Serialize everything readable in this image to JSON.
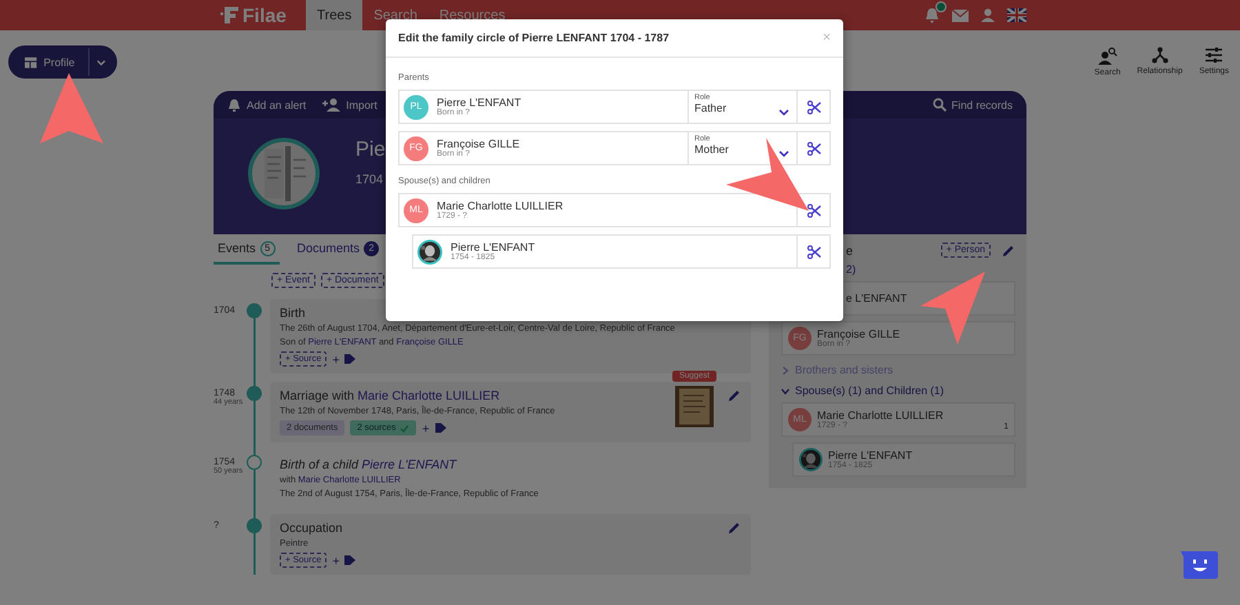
{
  "header": {
    "logo": "Filae",
    "nav": [
      {
        "label": "Trees",
        "selected": true
      },
      {
        "label": "Search",
        "selected": false
      },
      {
        "label": "Resources",
        "selected": false
      }
    ],
    "notification": true
  },
  "profile_button": {
    "label": "Profile"
  },
  "toolbar": [
    {
      "label": "Search",
      "kind": "search"
    },
    {
      "label": "Relationship",
      "kind": "relationship"
    },
    {
      "label": "Settings",
      "kind": "settings"
    }
  ],
  "profile_card": {
    "actions": [
      {
        "label": "Add an alert",
        "kind": "alert"
      },
      {
        "label": "Import",
        "kind": "import"
      }
    ],
    "find": "Find records",
    "name": "Pie",
    "dates": "1704"
  },
  "tabs": [
    {
      "label": "Events",
      "count": "5",
      "selected": true
    },
    {
      "label": "Documents",
      "count": "2",
      "selected": false
    }
  ],
  "add_buttons": [
    "+ Event",
    "+ Document"
  ],
  "events": [
    {
      "year": "1704",
      "filled": true,
      "kind": "card",
      "title": [
        {
          "text": "Birth"
        }
      ],
      "lines": [
        [
          {
            "text": "The 26th of August 1704, Anet, Département d'Eure-et-Loir, Centre-Val de Loire, Republic of France"
          }
        ],
        [
          {
            "text": "Son of "
          },
          {
            "text": "Pierre L'ENFANT",
            "link": true
          },
          {
            "text": " and "
          },
          {
            "text": "Françoise GILLE",
            "link": true
          }
        ]
      ],
      "tags": [
        {
          "kind": "add-source",
          "label": "+ Source"
        }
      ],
      "add_tag": "+"
    },
    {
      "year": "1748",
      "age": "44 years",
      "filled": true,
      "kind": "card",
      "editable": true,
      "suggestion": "Suggest",
      "title": [
        {
          "text": "Marriage with "
        },
        {
          "text": "Marie Charlotte LUILLIER",
          "link": true
        }
      ],
      "lines": [
        [
          {
            "text": "The 12th of November 1748, Paris, Île-de-France, Republic of France"
          }
        ]
      ],
      "tags": [
        {
          "kind": "documents",
          "label": "2 documents"
        },
        {
          "kind": "sources",
          "label": "2 sources",
          "checked": true
        }
      ],
      "add_tag": "+"
    },
    {
      "year": "1754",
      "age": "50 years",
      "filled": false,
      "kind": "plain",
      "title": [
        {
          "text": "Birth of a child "
        },
        {
          "text": "Pierre L'ENFANT",
          "link": true
        }
      ],
      "lines": [
        [
          {
            "text": "with "
          },
          {
            "text": "Marie Charlotte LUILLIER",
            "link": true
          }
        ],
        [
          {
            "text": "The 2nd of August 1754, Paris, Île-de-France, Republic of France"
          }
        ]
      ]
    },
    {
      "year": "?",
      "filled": true,
      "kind": "card",
      "editable": true,
      "title": [
        {
          "text": "Occupation"
        }
      ],
      "lines": [
        [
          {
            "text": "Peintre"
          }
        ]
      ],
      "tags": [
        {
          "kind": "add-source",
          "label": "+ Source"
        }
      ],
      "add_tag": "+"
    }
  ],
  "family_panel": {
    "title": "e",
    "add_person": "+ Person",
    "parents_label": "2)",
    "parents": [
      {
        "name": "e L'ENFANT"
      },
      {
        "name": "Françoise GILLE",
        "info": "Born in ?",
        "avatar": {
          "kind": "initials",
          "initials": "FG"
        }
      }
    ],
    "sections": [
      {
        "label": "Brothers and sisters",
        "expanded": false
      },
      {
        "label": "Spouse(s) (1) and Children (1)",
        "expanded": true,
        "members": [
          {
            "name": "Marie Charlotte LUILLIER",
            "info": "1729 - ?",
            "count": "1",
            "avatar": {
              "kind": "initials",
              "initials": "ML"
            }
          },
          {
            "name": "Pierre L'ENFANT",
            "info": "1754 - 1825",
            "child": true
          }
        ]
      }
    ]
  },
  "modal": {
    "title": "Edit the family circle of Pierre LENFANT 1704 - 1787",
    "close": "×",
    "groups": [
      {
        "label": "Parents",
        "members": [
          {
            "name": "Pierre L'ENFANT",
            "info": "Born in ?",
            "avatar": {
              "kind": "initials",
              "initials": "PL",
              "color": "#4cc6c6"
            },
            "role": {
              "label": "Role",
              "value": "Father"
            }
          },
          {
            "name": "Françoise GILLE",
            "info": "Born in ?",
            "avatar": {
              "kind": "initials",
              "initials": "FG",
              "color": "#f47c7c"
            },
            "role": {
              "label": "Role",
              "value": "Mother"
            }
          }
        ]
      },
      {
        "label": "Spouse(s) and children",
        "members": [
          {
            "name": "Marie Charlotte LUILLIER",
            "info": "1729 - ?",
            "avatar": {
              "kind": "initials",
              "initials": "ML",
              "color": "#f47c7c"
            }
          },
          {
            "name": "Pierre L'ENFANT",
            "info": "1754 - 1825",
            "child": true
          }
        ]
      }
    ]
  },
  "chat_widget": true
}
